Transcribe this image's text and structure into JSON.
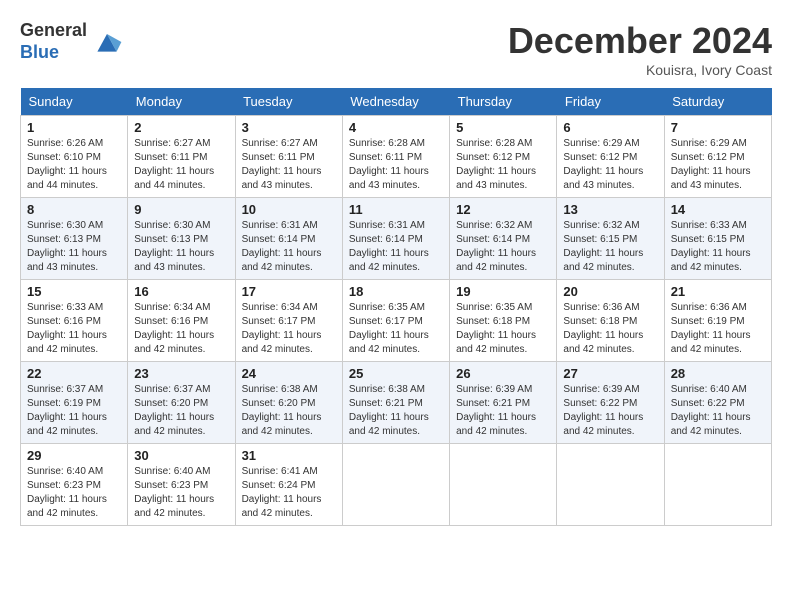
{
  "header": {
    "logo_general": "General",
    "logo_blue": "Blue",
    "month_title": "December 2024",
    "location": "Kouisra, Ivory Coast"
  },
  "days_of_week": [
    "Sunday",
    "Monday",
    "Tuesday",
    "Wednesday",
    "Thursday",
    "Friday",
    "Saturday"
  ],
  "weeks": [
    [
      {
        "day": "1",
        "sunrise": "6:26 AM",
        "sunset": "6:10 PM",
        "daylight": "11 hours and 44 minutes."
      },
      {
        "day": "2",
        "sunrise": "6:27 AM",
        "sunset": "6:11 PM",
        "daylight": "11 hours and 44 minutes."
      },
      {
        "day": "3",
        "sunrise": "6:27 AM",
        "sunset": "6:11 PM",
        "daylight": "11 hours and 43 minutes."
      },
      {
        "day": "4",
        "sunrise": "6:28 AM",
        "sunset": "6:11 PM",
        "daylight": "11 hours and 43 minutes."
      },
      {
        "day": "5",
        "sunrise": "6:28 AM",
        "sunset": "6:12 PM",
        "daylight": "11 hours and 43 minutes."
      },
      {
        "day": "6",
        "sunrise": "6:29 AM",
        "sunset": "6:12 PM",
        "daylight": "11 hours and 43 minutes."
      },
      {
        "day": "7",
        "sunrise": "6:29 AM",
        "sunset": "6:12 PM",
        "daylight": "11 hours and 43 minutes."
      }
    ],
    [
      {
        "day": "8",
        "sunrise": "6:30 AM",
        "sunset": "6:13 PM",
        "daylight": "11 hours and 43 minutes."
      },
      {
        "day": "9",
        "sunrise": "6:30 AM",
        "sunset": "6:13 PM",
        "daylight": "11 hours and 43 minutes."
      },
      {
        "day": "10",
        "sunrise": "6:31 AM",
        "sunset": "6:14 PM",
        "daylight": "11 hours and 42 minutes."
      },
      {
        "day": "11",
        "sunrise": "6:31 AM",
        "sunset": "6:14 PM",
        "daylight": "11 hours and 42 minutes."
      },
      {
        "day": "12",
        "sunrise": "6:32 AM",
        "sunset": "6:14 PM",
        "daylight": "11 hours and 42 minutes."
      },
      {
        "day": "13",
        "sunrise": "6:32 AM",
        "sunset": "6:15 PM",
        "daylight": "11 hours and 42 minutes."
      },
      {
        "day": "14",
        "sunrise": "6:33 AM",
        "sunset": "6:15 PM",
        "daylight": "11 hours and 42 minutes."
      }
    ],
    [
      {
        "day": "15",
        "sunrise": "6:33 AM",
        "sunset": "6:16 PM",
        "daylight": "11 hours and 42 minutes."
      },
      {
        "day": "16",
        "sunrise": "6:34 AM",
        "sunset": "6:16 PM",
        "daylight": "11 hours and 42 minutes."
      },
      {
        "day": "17",
        "sunrise": "6:34 AM",
        "sunset": "6:17 PM",
        "daylight": "11 hours and 42 minutes."
      },
      {
        "day": "18",
        "sunrise": "6:35 AM",
        "sunset": "6:17 PM",
        "daylight": "11 hours and 42 minutes."
      },
      {
        "day": "19",
        "sunrise": "6:35 AM",
        "sunset": "6:18 PM",
        "daylight": "11 hours and 42 minutes."
      },
      {
        "day": "20",
        "sunrise": "6:36 AM",
        "sunset": "6:18 PM",
        "daylight": "11 hours and 42 minutes."
      },
      {
        "day": "21",
        "sunrise": "6:36 AM",
        "sunset": "6:19 PM",
        "daylight": "11 hours and 42 minutes."
      }
    ],
    [
      {
        "day": "22",
        "sunrise": "6:37 AM",
        "sunset": "6:19 PM",
        "daylight": "11 hours and 42 minutes."
      },
      {
        "day": "23",
        "sunrise": "6:37 AM",
        "sunset": "6:20 PM",
        "daylight": "11 hours and 42 minutes."
      },
      {
        "day": "24",
        "sunrise": "6:38 AM",
        "sunset": "6:20 PM",
        "daylight": "11 hours and 42 minutes."
      },
      {
        "day": "25",
        "sunrise": "6:38 AM",
        "sunset": "6:21 PM",
        "daylight": "11 hours and 42 minutes."
      },
      {
        "day": "26",
        "sunrise": "6:39 AM",
        "sunset": "6:21 PM",
        "daylight": "11 hours and 42 minutes."
      },
      {
        "day": "27",
        "sunrise": "6:39 AM",
        "sunset": "6:22 PM",
        "daylight": "11 hours and 42 minutes."
      },
      {
        "day": "28",
        "sunrise": "6:40 AM",
        "sunset": "6:22 PM",
        "daylight": "11 hours and 42 minutes."
      }
    ],
    [
      {
        "day": "29",
        "sunrise": "6:40 AM",
        "sunset": "6:23 PM",
        "daylight": "11 hours and 42 minutes."
      },
      {
        "day": "30",
        "sunrise": "6:40 AM",
        "sunset": "6:23 PM",
        "daylight": "11 hours and 42 minutes."
      },
      {
        "day": "31",
        "sunrise": "6:41 AM",
        "sunset": "6:24 PM",
        "daylight": "11 hours and 42 minutes."
      },
      null,
      null,
      null,
      null
    ]
  ],
  "labels": {
    "sunrise": "Sunrise:",
    "sunset": "Sunset:",
    "daylight": "Daylight:"
  }
}
